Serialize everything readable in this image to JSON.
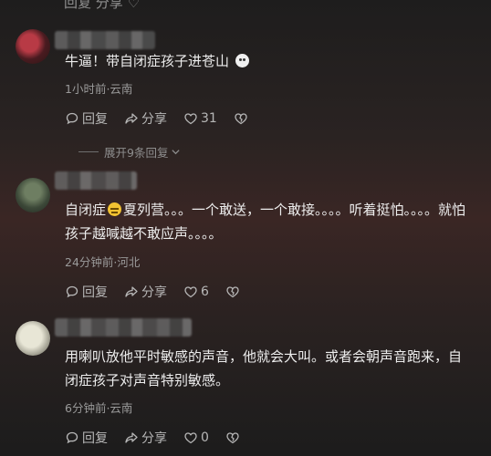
{
  "top_cut": {
    "text": "回复  分享  ♡"
  },
  "comments": [
    {
      "text_parts": [
        "牛逼！带自闭症孩子进苍山",
        ""
      ],
      "meta": "1小时前·云南",
      "reply_label": "回复",
      "share_label": "分享",
      "likes": "31",
      "expand_label": "展开9条回复"
    },
    {
      "text_lead": "自闭症",
      "text_rest": "夏列营。。。一个敢送，一个敢接。。。。听着挺怕。。。。就怕孩子越喊越不敢应声。。。。",
      "meta": "24分钟前·河北",
      "reply_label": "回复",
      "share_label": "分享",
      "likes": "6"
    },
    {
      "text": "用喇叭放他平时敏感的声音，他就会大叫。或者会朝声音跑来，自闭症孩子对声音特别敏感。",
      "meta": "6分钟前·云南",
      "reply_label": "回复",
      "share_label": "分享",
      "likes": "0"
    }
  ],
  "icons": [
    "reply-icon",
    "share-icon",
    "heart-icon",
    "dislike-icon",
    "chevron-down-icon",
    "cat-emoji",
    "sweat-emoji"
  ]
}
